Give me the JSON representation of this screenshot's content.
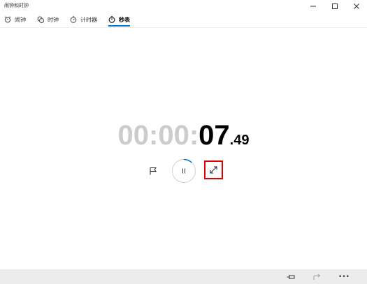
{
  "window": {
    "title": "闹钟和时钟"
  },
  "tabs": [
    {
      "label": "闹钟",
      "icon": "alarm-icon"
    },
    {
      "label": "时钟",
      "icon": "world-clock-icon"
    },
    {
      "label": "计时器",
      "icon": "timer-icon"
    },
    {
      "label": "秒表",
      "icon": "stopwatch-icon",
      "active": true
    }
  ],
  "stopwatch": {
    "hours": "00",
    "sep1": ":",
    "minutes": "00",
    "sep2": ":",
    "seconds": "07",
    "fraction": ".49",
    "progress": 0.12
  },
  "controls": {
    "lap_icon": "flag-icon",
    "pause_icon": "pause-icon",
    "expand_icon": "expand-icon"
  },
  "bottom_bar": {
    "more_label": "•••"
  },
  "colors": {
    "accent": "#0078d4",
    "highlight_box": "#e00000",
    "muted_digits": "#cccccc"
  }
}
